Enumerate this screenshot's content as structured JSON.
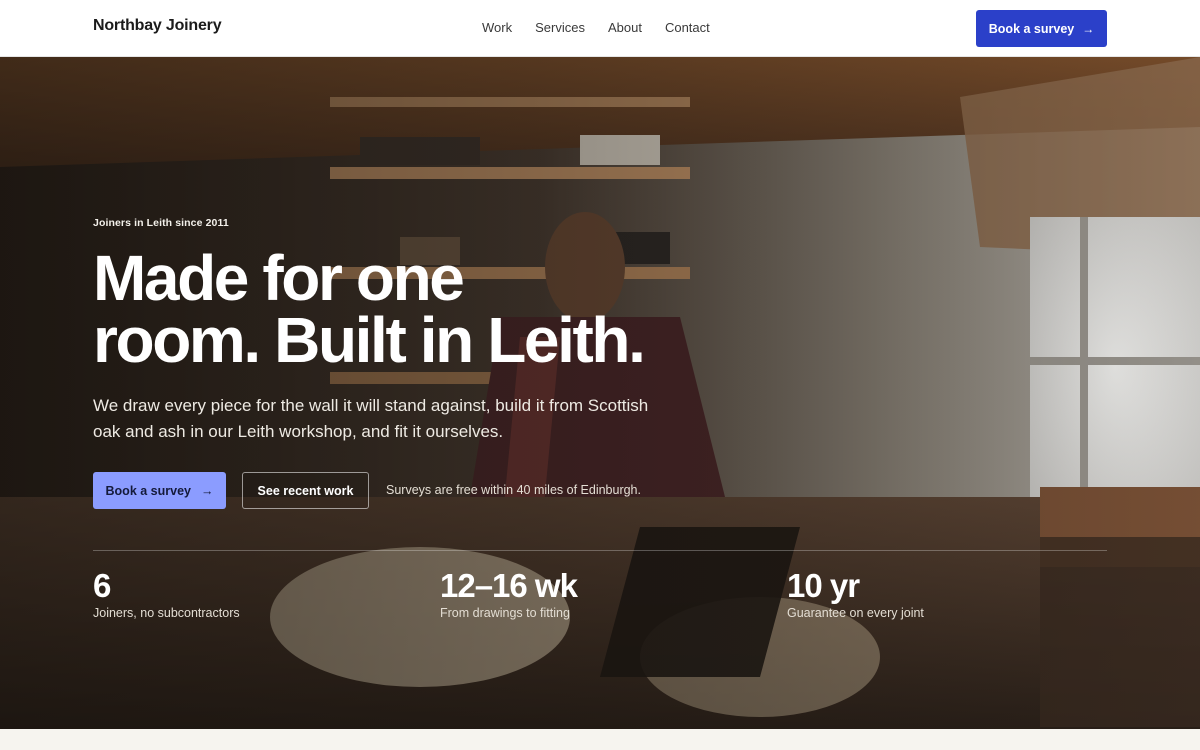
{
  "nav": {
    "brand": "Northbay Joinery",
    "links": [
      "Work",
      "Services",
      "About",
      "Contact"
    ],
    "cta_label": "Book a survey",
    "cta_arrow": "→"
  },
  "hero": {
    "eyebrow": "Joiners in Leith since 2011",
    "headline_line1": "Made for one",
    "headline_line2": "room. Built in Leith.",
    "lede": "We draw every piece for the wall it will stand against, build it from Scottish oak and ash in our Leith workshop, and fit it ourselves.",
    "primary_label": "Book a survey",
    "primary_arrow": "→",
    "secondary_label": "See recent work",
    "note": "Surveys are free within 40 miles of Edinburgh."
  },
  "stats": [
    {
      "value": "6",
      "label": "Joiners, no subcontractors"
    },
    {
      "value": "12–16 wk",
      "label": "From drawings to fitting"
    },
    {
      "value": "10 yr",
      "label": "Guarantee on every joint"
    }
  ],
  "colors": {
    "accent": "#2b40c9",
    "accent_light": "#8b9cff"
  },
  "image": {
    "subject": "hero-photo"
  }
}
